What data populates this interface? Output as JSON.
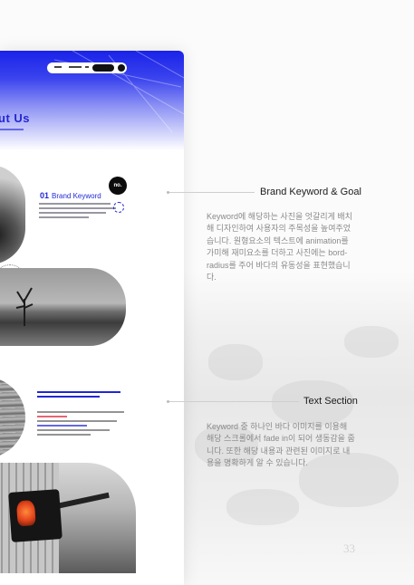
{
  "mockup": {
    "hero_title": "ut Us",
    "side_badge": "no.",
    "brand_label_num": "01",
    "brand_label_text": "Brand Keyword"
  },
  "annotations": [
    {
      "heading": "Brand Keyword & Goal",
      "body_lines": [
        "Keyword에 해당하는 사진을 엇갈리게 배치",
        "해 디자인하여 사용자의 주목성을 높여주었",
        "습니다. 원형요소의 텍스트에 animation를",
        "가미해 재미요소를 더하고 사진에는 bord-",
        "radius를 주어 바다의 유동성을 표현했습니",
        "다."
      ]
    },
    {
      "heading": "Text Section",
      "body_lines": [
        "Keyword 중 하나인 바다 이미지를 이용해",
        "해당 스크롤에서 fade in이 되어 생동감을 줍",
        "니다. 또한 해당 내용과 관련된 이미지로 내",
        "용을 명확하게 알 수 있습니다."
      ]
    }
  ],
  "page_number": "33",
  "colors": {
    "accent": "#2227d4",
    "heading": "#1b1b1b",
    "body": "#8a8a8a"
  }
}
